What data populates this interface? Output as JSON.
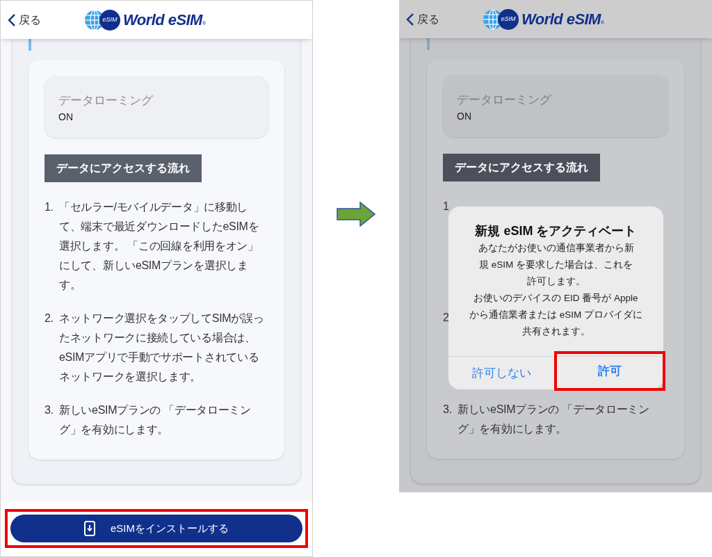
{
  "left_screen": {
    "header": {
      "back": "戻る",
      "logo": {
        "badge": "eSIM",
        "name": "World eSIM",
        "mark": "®"
      }
    },
    "roaming": {
      "label": "データローミング",
      "value": "ON"
    },
    "section_title": "データにアクセスする流れ",
    "steps": [
      {
        "number": "1.",
        "text": "「セルラー/モバイルデータ」に移動して、端末で最近ダウンロードしたeSIMを選択します。 「この回線を利用をオン」にして、新しいeSIMプランを選択します。"
      },
      {
        "number": "2.",
        "text": "ネットワーク選択をタップしてSIMが誤ったネットワークに接続している場合は、eSIMアプリで手動でサポートされているネットワークを選択します。"
      },
      {
        "number": "3.",
        "text": "新しいeSIMプランの 「データローミング」を有効にします。"
      }
    ],
    "install_button": {
      "label": "eSIMをインストールする",
      "highlighted": true
    }
  },
  "right_screen": {
    "header": {
      "back": "戻る",
      "logo": {
        "badge": "eSIM",
        "name": "World eSIM",
        "mark": "®"
      }
    },
    "roaming": {
      "label": "データローミング",
      "value": "ON"
    },
    "section_title": "データにアクセスする流れ",
    "steps": [
      {
        "number": "1"
      },
      {
        "number": "2"
      },
      {
        "number": "3.",
        "text": "新しいeSIMプランの 「データローミング」を有効にします。"
      }
    ],
    "dialog": {
      "title": "新規 eSIM をアクティベート",
      "lines": [
        "あなたがお使いの通信事業者から新",
        "規 eSIM を要求した場合は、これを",
        "許可します。",
        "お使いのデバイスの EID 番号が Apple",
        "から通信業者または eSIM プロバイダに",
        "共有されます。"
      ],
      "buttons": [
        {
          "label": "許可しない",
          "bold": false,
          "highlighted": false
        },
        {
          "label": "許可",
          "bold": true,
          "highlighted": true
        }
      ]
    }
  }
}
